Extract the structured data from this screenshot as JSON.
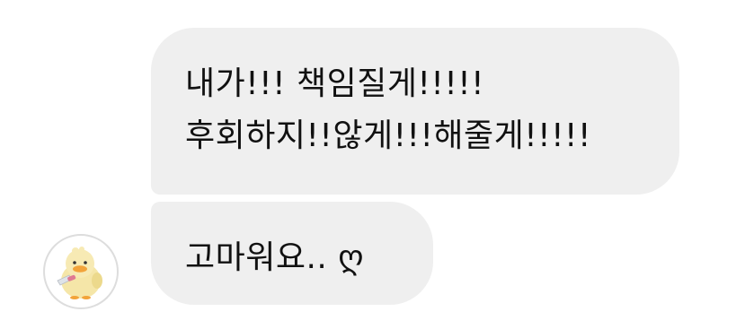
{
  "messages": [
    {
      "sender": "other",
      "lines": [
        "내가!!! 책임질게!!!!!",
        "후회하지!!않게!!!해줄게!!!!!"
      ]
    },
    {
      "sender": "other",
      "lines": [
        "고마워요.. ღ"
      ]
    }
  ],
  "avatar": {
    "icon": "chick-with-knife-icon"
  },
  "colors": {
    "bubble_bg": "#efefef",
    "text": "#111111",
    "background": "#ffffff"
  }
}
